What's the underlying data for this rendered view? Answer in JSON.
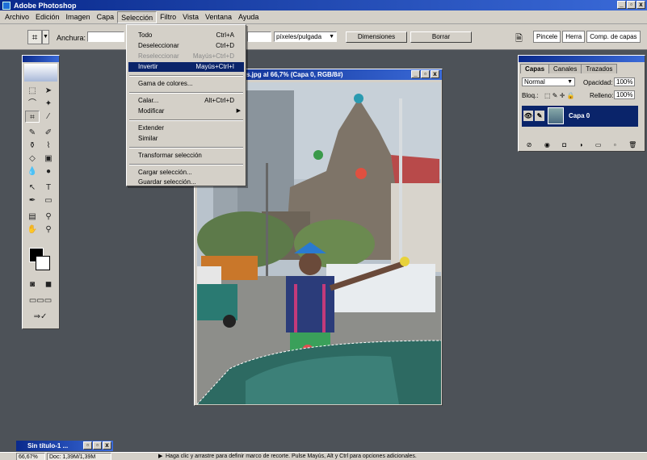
{
  "app": {
    "title": "Adobe Photoshop"
  },
  "window_buttons": {
    "minimize": "_",
    "restore": "▫",
    "close": "x"
  },
  "menubar": [
    "Archivo",
    "Edición",
    "Imagen",
    "Capa",
    "Selección",
    "Filtro",
    "Vista",
    "Ventana",
    "Ayuda"
  ],
  "options_bar": {
    "tool_icon": "crop-icon",
    "width_label": "Anchura:",
    "width_value": "",
    "resolution_value": "",
    "units_value": "píxeles/pulgada",
    "front_image_button": "Dimensiones",
    "clear_button": "Borrar",
    "well_tabs": [
      "Pincele",
      "Herra",
      "Comp. de capas"
    ]
  },
  "document": {
    "title": "s.jpg al 66,7% (Capa 0, RGB/8#)"
  },
  "selection_menu": {
    "items": [
      {
        "label": "Todo",
        "shortcut": "Ctrl+A",
        "disabled": false
      },
      {
        "label": "Deseleccionar",
        "shortcut": "Ctrl+D",
        "disabled": false
      },
      {
        "label": "Reseleccionar",
        "shortcut": "Mayús+Ctrl+D",
        "disabled": true
      },
      {
        "label": "Invertir",
        "shortcut": "Mayús+Ctrl+I",
        "disabled": false,
        "highlighted": true
      },
      {
        "label": "Gama de colores...",
        "shortcut": "",
        "disabled": false
      },
      {
        "label": "Calar...",
        "shortcut": "Alt+Ctrl+D",
        "disabled": false
      },
      {
        "label": "Modificar",
        "shortcut": "",
        "disabled": false,
        "submenu": true
      },
      {
        "label": "Extender",
        "shortcut": "",
        "disabled": false
      },
      {
        "label": "Similar",
        "shortcut": "",
        "disabled": false
      },
      {
        "label": "Transformar selección",
        "shortcut": "",
        "disabled": false
      },
      {
        "label": "Cargar selección...",
        "shortcut": "",
        "disabled": false
      },
      {
        "label": "Guardar selección...",
        "shortcut": "",
        "disabled": false
      }
    ]
  },
  "layers_panel": {
    "tabs": [
      "Capas",
      "Canales",
      "Trazados"
    ],
    "blend_mode": "Normal",
    "opacity_label": "Opacidad:",
    "opacity_value": "100%",
    "lock_label": "Bloq.:",
    "fill_label": "Relleno:",
    "fill_value": "100%",
    "layer_name": "Capa 0",
    "footer_icons": [
      "link-layers-icon",
      "layer-style-icon",
      "mask-icon",
      "adjustment-icon",
      "folder-icon",
      "new-layer-icon",
      "trash-icon"
    ]
  },
  "minimized_window": {
    "title": "Sin título-1 ..."
  },
  "status_bar": {
    "zoom": "66,67%",
    "doc_size": "Doc: 1,39M/1,39M",
    "message": "Haga clic y arrastre para definir marco de recorte. Pulse Mayús, Alt y Ctrl para opciones adicionales."
  },
  "colors": {
    "title_blue": "#0a246a",
    "chrome": "#d4d0c8",
    "workspace": "#4d5258"
  }
}
